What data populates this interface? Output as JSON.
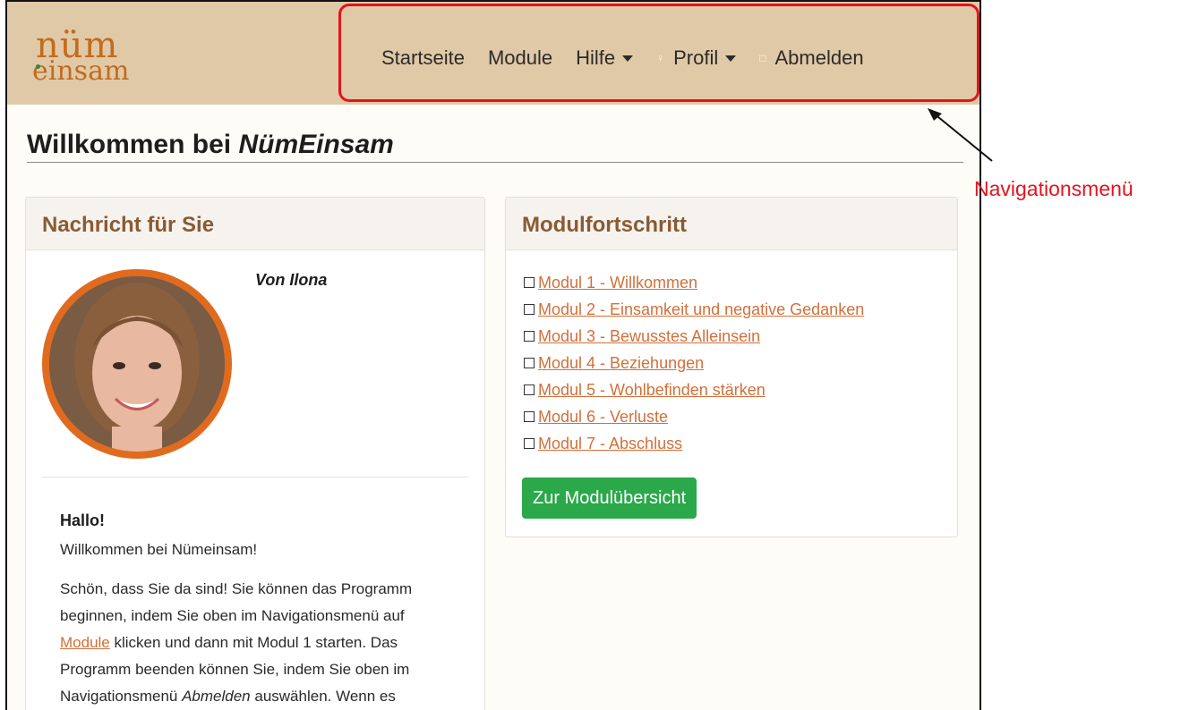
{
  "logo": {
    "line1": "nüm",
    "line2": "einsam"
  },
  "nav": {
    "startseite": "Startseite",
    "module": "Module",
    "hilfe": "Hilfe",
    "profil": "Profil",
    "abmelden": "Abmelden"
  },
  "annotation": {
    "label": "Navigationsmenü",
    "color": "#e3141e"
  },
  "page": {
    "title_prefix": "Willkommen bei ",
    "title_emph": "NümEinsam"
  },
  "message_card": {
    "title": "Nachricht für Sie",
    "from": "Von Ilona",
    "greeting": "Hallo!",
    "welcome": "Willkommen bei Nümeinsam!",
    "p1_line1": "Schön, dass Sie da sind! Sie können das Programm",
    "p1_line2": "beginnen, indem Sie oben im Navigationsmenü auf",
    "p1_link": "Module",
    "p1_line3_rest": " klicken und dann mit Modul 1 starten. Das",
    "p1_line4": "Programm beenden können Sie, indem Sie oben im",
    "p1_line5_pre": "Navigationsmenü ",
    "p1_line5_em": "Abmelden",
    "p1_line5_post": " auswählen. Wenn es"
  },
  "progress_card": {
    "title": "Modulfortschritt",
    "modules": [
      "Modul 1 - Willkommen",
      "Modul 2 - Einsamkeit und negative Gedanken",
      "Modul 3 - Bewusstes Alleinsein",
      "Modul 4 - Beziehungen",
      "Modul 5 - Wohlbefinden stärken",
      "Modul 6 - Verluste",
      "Modul 7 - Abschluss"
    ],
    "button": "Zur Modulübersicht"
  },
  "colors": {
    "navbar": "#e0c9a6",
    "accent": "#d2703a",
    "button": "#2aa84a",
    "card_title": "#8a5a33"
  }
}
